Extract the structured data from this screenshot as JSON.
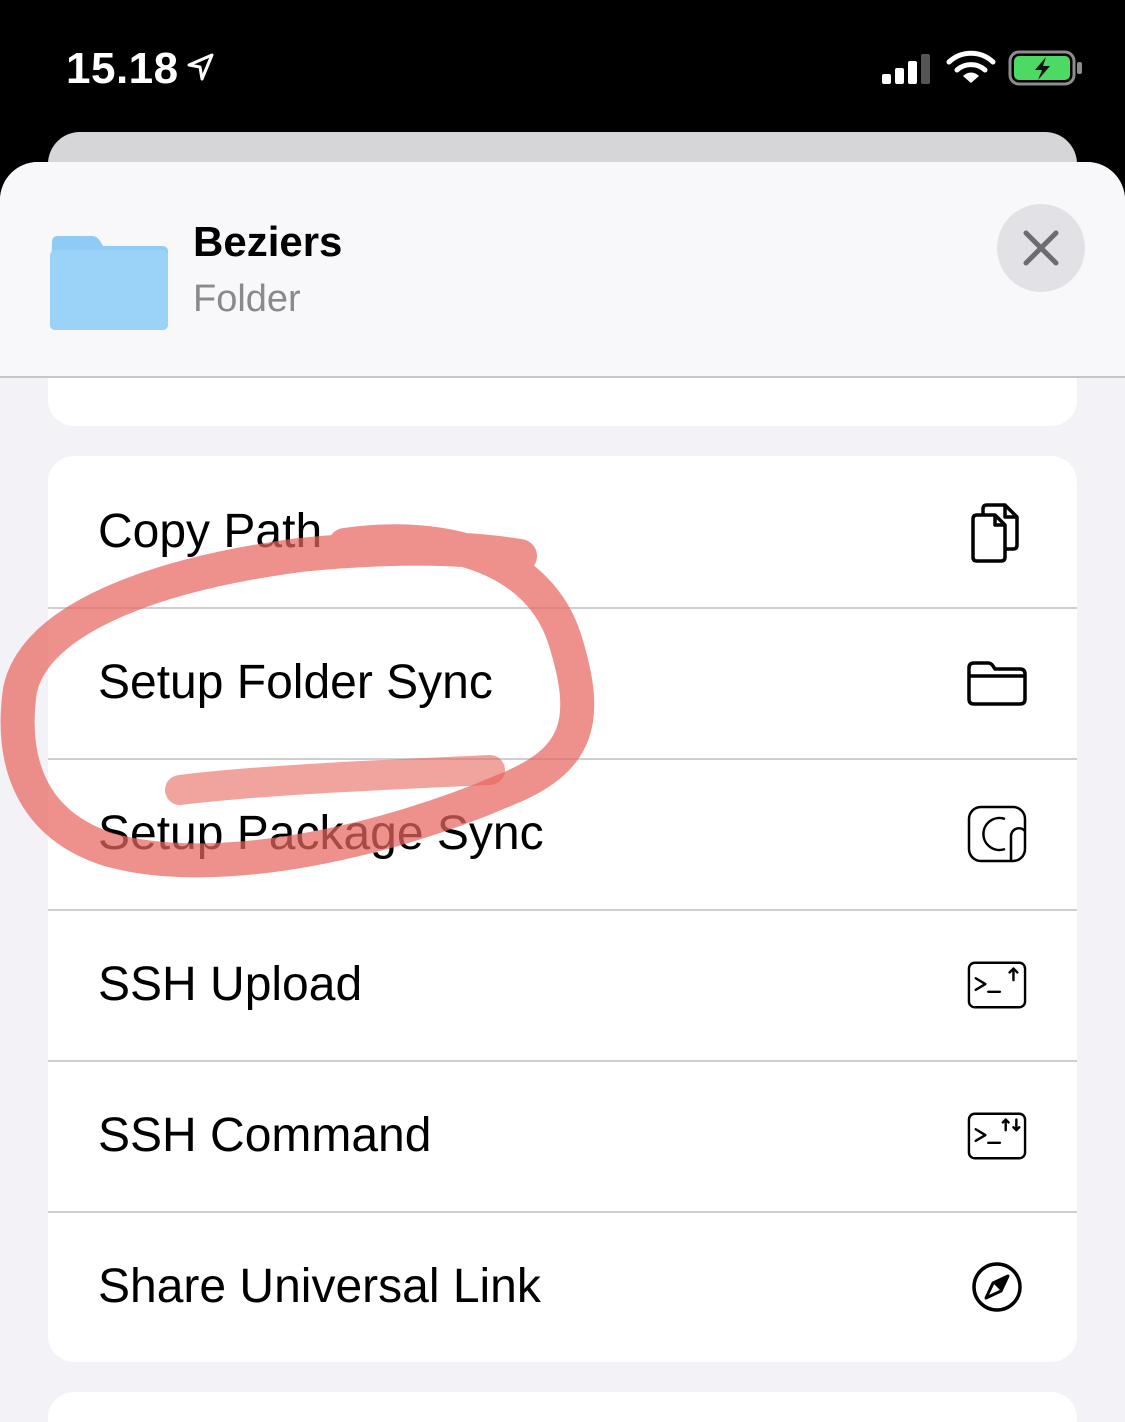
{
  "status_bar": {
    "time": "15.18",
    "icons": [
      "location-arrow-icon",
      "cellular-signal-icon",
      "wifi-icon",
      "battery-charging-icon"
    ],
    "battery_color": "#4cd964"
  },
  "sheet": {
    "item_name": "Beziers",
    "item_kind": "Folder",
    "folder_icon_color": "#8ecbf5",
    "close_icon": "close-icon"
  },
  "actions": [
    {
      "label": "Copy Path",
      "icon": "copy-icon"
    },
    {
      "label": "Setup Folder Sync",
      "icon": "folder-icon"
    },
    {
      "label": "Setup Package Sync",
      "icon": "package-icon"
    },
    {
      "label": "SSH Upload",
      "icon": "terminal-upload-icon"
    },
    {
      "label": "SSH Command",
      "icon": "terminal-command-icon"
    },
    {
      "label": "Share Universal Link",
      "icon": "compass-icon"
    }
  ],
  "annotation": {
    "color": "#e8655e",
    "highlighted_action": "Setup Folder Sync"
  }
}
